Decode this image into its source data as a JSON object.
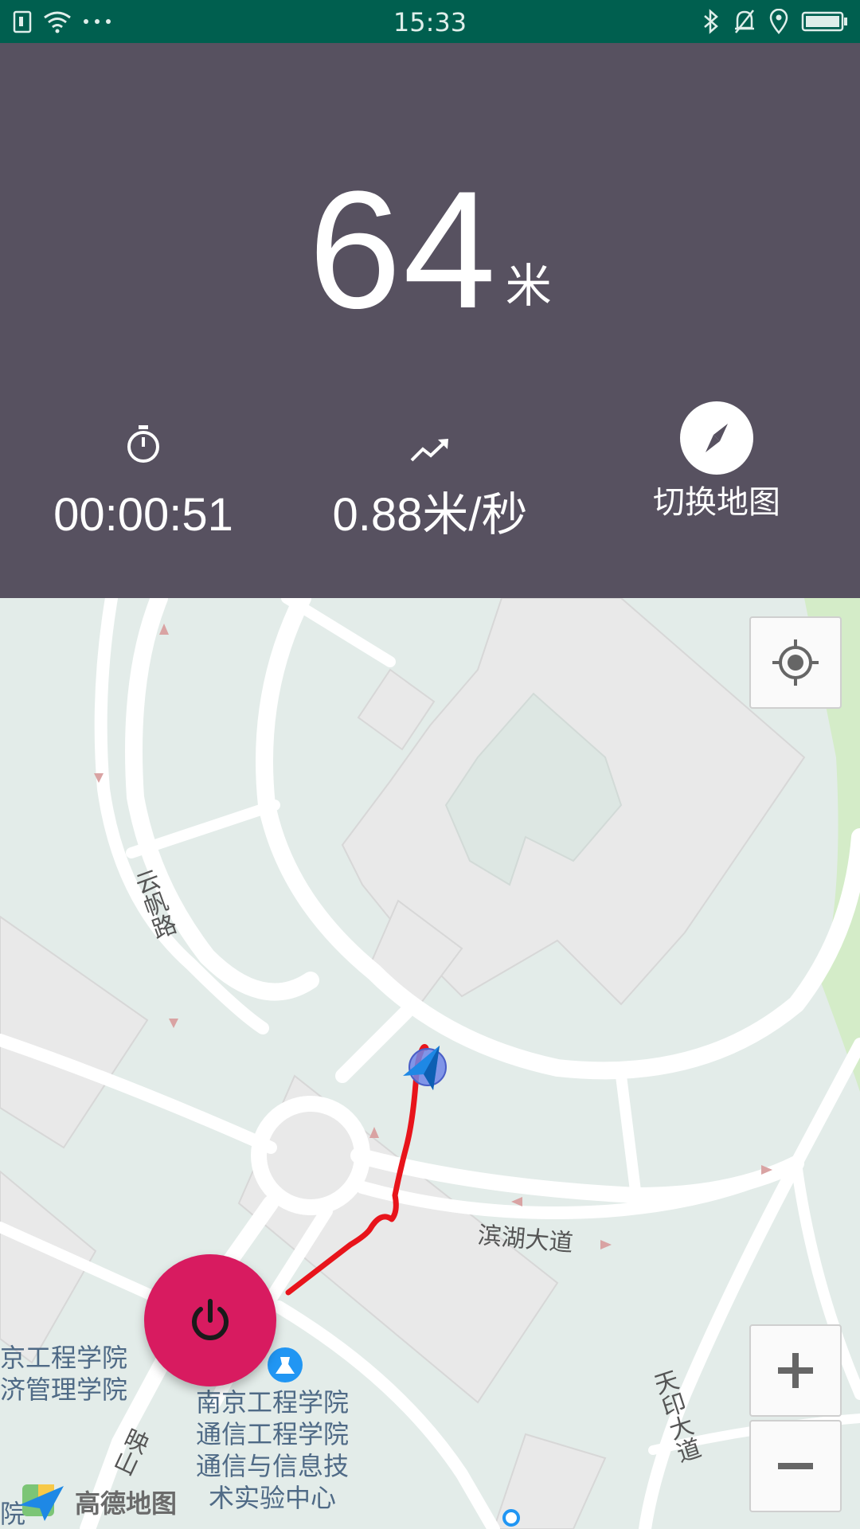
{
  "status_bar": {
    "time": "15:33",
    "icons_left": [
      "sim-icon",
      "wifi-icon",
      "more-dots-icon"
    ],
    "icons_right": [
      "bluetooth-icon",
      "alarm-icon",
      "location-icon",
      "battery-icon"
    ]
  },
  "stats": {
    "distance_value": "64",
    "distance_unit": "米",
    "duration": "00:00:51",
    "speed": "0.88米/秒",
    "switch_map_label": "切换地图"
  },
  "map": {
    "roads": [
      "云帆路",
      "滨湖大道",
      "天印大道",
      "映山"
    ],
    "pois": [
      "京工程学院",
      "济管理学院",
      "南京工程学院",
      "通信工程学院",
      "通信与信息技",
      "术实验中心",
      "院",
      "天"
    ],
    "logo_text": "高德地图",
    "accent_color": "#d81b60",
    "track_color": "#e8141b"
  }
}
